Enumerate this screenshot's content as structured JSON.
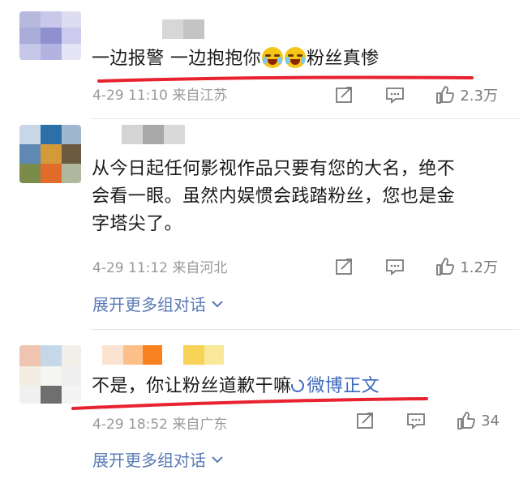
{
  "comments": [
    {
      "text_before": "一边报警 一边抱抱你",
      "text_after": "粉丝真惨",
      "emoji": [
        "laugh-cry-emoji",
        "laugh-cry-emoji"
      ],
      "date": "4-29",
      "time": "11:10",
      "location": "来自江苏",
      "likes": "2.3万"
    },
    {
      "text_line1": "从今日起任何影视作品只要有您的大名，绝不",
      "text_line2": "会看一眼。虽然内娱惯会践踏粉丝，您也是金",
      "text_line3": "字塔尖了。",
      "date": "4-29",
      "time": "11:12",
      "location": "来自河北",
      "likes": "1.2万",
      "expand": "展开更多组对话"
    },
    {
      "text": "不是，你让粉丝道歉干嘛",
      "link": "微博正文",
      "date": "4-29",
      "time": "18:52",
      "location": "来自广东",
      "likes": "34",
      "expand": "展开更多组对话"
    }
  ],
  "colors": {
    "accent_link": "#3d6bbf",
    "expand_link": "#5a7bb5",
    "annotation_underline": "#e8222f",
    "meta_text": "#9a9a9a"
  }
}
